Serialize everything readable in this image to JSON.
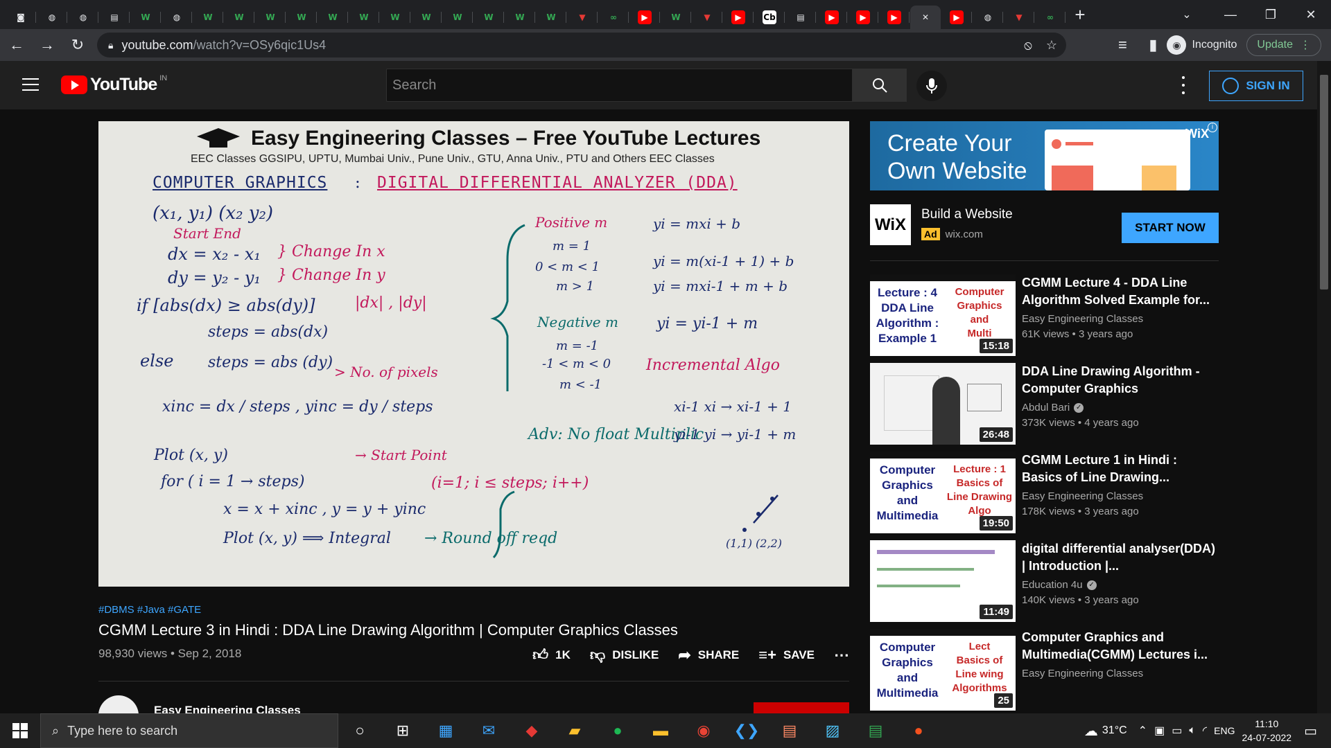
{
  "browser": {
    "tabs": [
      {
        "icon": "camera-icon",
        "glyph": "◙",
        "color": "#e8eaed",
        "bg": "transparent"
      },
      {
        "icon": "globe-icon",
        "glyph": "◍",
        "color": "#e8eaed",
        "bg": "transparent"
      },
      {
        "icon": "globe-icon",
        "glyph": "◍",
        "color": "#e8eaed",
        "bg": "transparent"
      },
      {
        "icon": "doc-icon",
        "glyph": "▤",
        "color": "#e8eaed",
        "bg": "transparent"
      },
      {
        "icon": "wiki-w-icon",
        "glyph": "W",
        "color": "#34a853",
        "bg": "transparent"
      },
      {
        "icon": "globe-icon",
        "glyph": "◍",
        "color": "#e8eaed",
        "bg": "transparent"
      },
      {
        "icon": "wiki-w-icon",
        "glyph": "W",
        "color": "#34a853",
        "bg": "transparent"
      },
      {
        "icon": "wiki-w-icon",
        "glyph": "W",
        "color": "#34a853",
        "bg": "transparent"
      },
      {
        "icon": "wiki-w-icon",
        "glyph": "W",
        "color": "#34a853",
        "bg": "transparent"
      },
      {
        "icon": "wiki-w-icon",
        "glyph": "W",
        "color": "#34a853",
        "bg": "transparent"
      },
      {
        "icon": "wiki-w-icon",
        "glyph": "W",
        "color": "#34a853",
        "bg": "transparent"
      },
      {
        "icon": "wiki-w-icon",
        "glyph": "W",
        "color": "#34a853",
        "bg": "transparent"
      },
      {
        "icon": "wiki-w-icon",
        "glyph": "W",
        "color": "#34a853",
        "bg": "transparent"
      },
      {
        "icon": "wiki-w-icon",
        "glyph": "W",
        "color": "#34a853",
        "bg": "transparent"
      },
      {
        "icon": "wiki-w-icon",
        "glyph": "W",
        "color": "#34a853",
        "bg": "transparent"
      },
      {
        "icon": "wiki-w-icon",
        "glyph": "W",
        "color": "#34a853",
        "bg": "transparent"
      },
      {
        "icon": "wiki-w-icon",
        "glyph": "W",
        "color": "#34a853",
        "bg": "transparent"
      },
      {
        "icon": "wiki-w-icon",
        "glyph": "W",
        "color": "#34a853",
        "bg": "transparent"
      },
      {
        "icon": "vidyard-icon",
        "glyph": "▼",
        "color": "#e53935",
        "bg": "transparent"
      },
      {
        "icon": "infinity-icon",
        "glyph": "∞",
        "color": "#34a853",
        "bg": "transparent"
      },
      {
        "icon": "youtube-icon",
        "glyph": "▶",
        "color": "#fff",
        "bg": "#ff0000"
      },
      {
        "icon": "wiki-w-icon",
        "glyph": "W",
        "color": "#34a853",
        "bg": "transparent"
      },
      {
        "icon": "vidyard-icon",
        "glyph": "▼",
        "color": "#e53935",
        "bg": "transparent"
      },
      {
        "icon": "youtube-icon",
        "glyph": "▶",
        "color": "#fff",
        "bg": "#ff0000"
      },
      {
        "icon": "cb-icon",
        "glyph": "Cb",
        "color": "#000",
        "bg": "#fff"
      },
      {
        "icon": "doc-icon",
        "glyph": "▤",
        "color": "#e8eaed",
        "bg": "transparent"
      },
      {
        "icon": "youtube-icon",
        "glyph": "▶",
        "color": "#fff",
        "bg": "#ff0000"
      },
      {
        "icon": "youtube-icon",
        "glyph": "▶",
        "color": "#fff",
        "bg": "#ff0000"
      },
      {
        "icon": "youtube-icon",
        "glyph": "▶",
        "color": "#fff",
        "bg": "#ff0000"
      },
      {
        "icon": "close-icon",
        "glyph": "✕",
        "color": "#e8eaed",
        "bg": "transparent",
        "active": true
      },
      {
        "icon": "youtube-icon",
        "glyph": "▶",
        "color": "#fff",
        "bg": "#ff0000"
      },
      {
        "icon": "globe-icon",
        "glyph": "◍",
        "color": "#e8eaed",
        "bg": "transparent"
      },
      {
        "icon": "vidyard-icon",
        "glyph": "▼",
        "color": "#e53935",
        "bg": "transparent"
      },
      {
        "icon": "infinity-icon",
        "glyph": "∞",
        "color": "#34a853",
        "bg": "transparent"
      }
    ],
    "url_host": "youtube.com",
    "url_path": "/watch?v=OSy6qic1Us4",
    "incognito_label": "Incognito",
    "update_label": "Update"
  },
  "yt": {
    "logo_text": "YouTube",
    "country_code": "IN",
    "search_placeholder": "Search",
    "signin_label": "SIGN IN"
  },
  "video": {
    "board": {
      "title": "Easy Engineering Classes – Free YouTube Lectures",
      "subtitle": "EEC Classes    GGSIPU, UPTU, Mumbai Univ., Pune Univ., GTU, Anna Univ., PTU and Others    EEC Classes",
      "heading_left": "COMPUTER  GRAPHICS",
      "heading_colon": ":",
      "heading_right": "DIGITAL  DIFFERENTIAL  ANALYZER  (DDA)",
      "lines": [
        {
          "t": "(x₁, y₁)          (x₂ y₂)",
          "c": "navy"
        },
        {
          "t": "Start                End",
          "c": "pink"
        },
        {
          "t": "dx = x₂ - x₁",
          "c": "navy"
        },
        {
          "t": "} Change  In  x",
          "c": "pink"
        },
        {
          "t": "dy = y₂ - y₁",
          "c": "navy"
        },
        {
          "t": "} Change  In  y",
          "c": "pink"
        },
        {
          "t": "if [abs(dx) ≥ abs(dy)]",
          "c": "navy"
        },
        {
          "t": "|dx| , |dy|",
          "c": "pink"
        },
        {
          "t": "steps = abs(dx)",
          "c": "navy"
        },
        {
          "t": "else",
          "c": "navy"
        },
        {
          "t": "steps = abs (dy)",
          "c": "navy"
        },
        {
          "t": "> No. of pixels",
          "c": "pink"
        },
        {
          "t": "xinc = dx / steps ,  yinc = dy / steps",
          "c": "navy"
        },
        {
          "t": "Plot (x, y)",
          "c": "navy"
        },
        {
          "t": "→  Start  Point",
          "c": "pink"
        },
        {
          "t": "for ( i = 1 → steps)",
          "c": "navy"
        },
        {
          "t": "x = x + xinc ,  y = y + yinc",
          "c": "navy"
        },
        {
          "t": "Plot (x, y)  ⟹  Integral",
          "c": "navy"
        },
        {
          "t": "(i=1; i ≤ steps; i++)",
          "c": "pink"
        },
        {
          "t": "→  Round  off  reqd",
          "c": "teal"
        },
        {
          "t": "Positive m",
          "c": "pink"
        },
        {
          "t": "m = 1",
          "c": "navy"
        },
        {
          "t": "0 < m < 1",
          "c": "navy"
        },
        {
          "t": "m > 1",
          "c": "navy"
        },
        {
          "t": "Negative m",
          "c": "teal"
        },
        {
          "t": "m = -1",
          "c": "navy"
        },
        {
          "t": "-1 < m < 0",
          "c": "navy"
        },
        {
          "t": "m < -1",
          "c": "navy"
        },
        {
          "t": "Adv:  No float Multiplic",
          "c": "teal"
        },
        {
          "t": "yi = mxi + b",
          "c": "navy"
        },
        {
          "t": "yi = m(xi-1 + 1) + b",
          "c": "navy"
        },
        {
          "t": "yi = mxi-1 + m + b",
          "c": "navy"
        },
        {
          "t": "yi = yi-1 + m",
          "c": "navy"
        },
        {
          "t": "Incremental  Algo",
          "c": "pink"
        },
        {
          "t": "xi-1      xi → xi-1 + 1",
          "c": "navy"
        },
        {
          "t": "yi-1      yi → yi-1 + m",
          "c": "navy"
        },
        {
          "t": "(1,1)   (2,2)",
          "c": "navy"
        }
      ]
    },
    "hashtags": "#DBMS #Java #GATE",
    "title": "CGMM Lecture 3 in Hindi : DDA Line Drawing Algorithm | Computer Graphics Classes",
    "stats": "98,930 views • Sep 2, 2018",
    "like_count": "1K",
    "dislike_label": "DISLIKE",
    "share_label": "SHARE",
    "save_label": "SAVE",
    "channel_name": "Easy Engineering Classes"
  },
  "ad": {
    "banner_headline_1": "Create Your",
    "banner_headline_2": "Own Website",
    "banner_brand": "WiX",
    "logo_text": "WiX",
    "title": "Build a Website",
    "badge": "Ad",
    "domain": "wix.com",
    "cta": "START NOW"
  },
  "recommendations": [
    {
      "title": "CGMM Lecture 4 - DDA Line Algorithm Solved Example for...",
      "channel": "Easy Engineering Classes",
      "verified": false,
      "views": "61K views • 3 years ago",
      "duration": "15:18",
      "thumb_left": "Lecture : 4\nDDA Line\nAlgorithm :\nExample 1",
      "thumb_right": "Computer\nGraphics\nand\nMulti"
    },
    {
      "title": "DDA Line Drawing Algorithm - Computer Graphics",
      "channel": "Abdul Bari",
      "verified": true,
      "views": "373K views • 4 years ago",
      "duration": "26:48",
      "thumb_left": "",
      "thumb_right": ""
    },
    {
      "title": "CGMM Lecture 1 in Hindi : Basics of Line Drawing...",
      "channel": "Easy Engineering Classes",
      "verified": false,
      "views": "178K views • 3 years ago",
      "duration": "19:50",
      "thumb_left": "Computer\nGraphics\nand\nMultimedia",
      "thumb_right": "Lecture : 1\nBasics of\nLine Drawing\nAlgo"
    },
    {
      "title": "digital differential analyser(DDA) | Introduction |...",
      "channel": "Education 4u",
      "verified": true,
      "views": "140K views • 3 years ago",
      "duration": "11:49",
      "thumb_left": "",
      "thumb_right": ""
    },
    {
      "title": "Computer Graphics and Multimedia(CGMM) Lectures i...",
      "channel": "Easy Engineering Classes",
      "verified": false,
      "views": "",
      "duration": "25",
      "thumb_left": "Computer\nGraphics\nand\nMultimedia",
      "thumb_right": "Lect\nBasics of\nLine    wing\nAlgorithms"
    }
  ],
  "taskbar": {
    "search_placeholder": "Type here to search",
    "temperature": "31°C",
    "language": "ENG",
    "time": "11:10",
    "date": "24-07-2022"
  }
}
